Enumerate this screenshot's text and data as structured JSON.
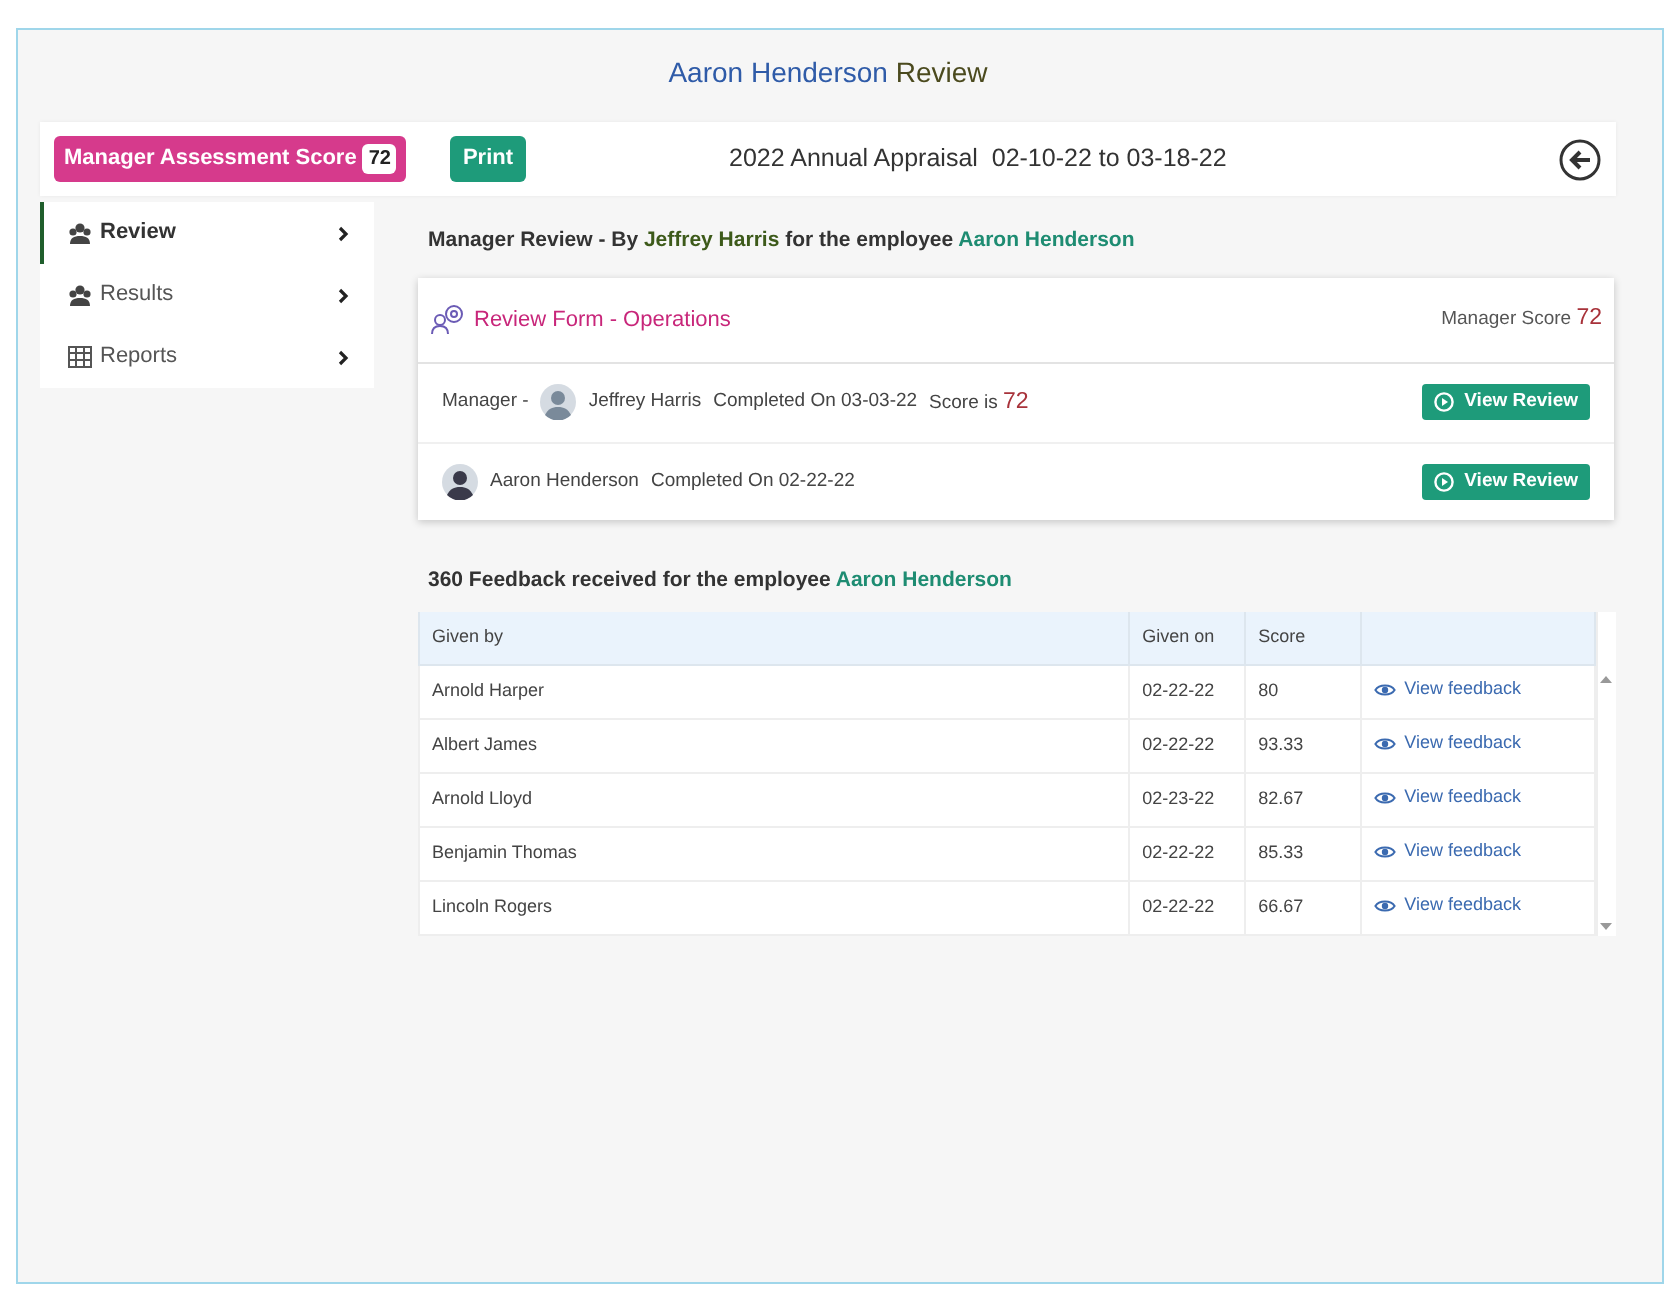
{
  "title": {
    "name": "Aaron Henderson",
    "suffix": "Review"
  },
  "toolbar": {
    "score_label": "Manager Assessment Score",
    "score": "72",
    "print": "Print",
    "appraisal": "2022 Annual Appraisal",
    "date_from": "02-10-22",
    "date_to_word": "to",
    "date_to": "03-18-22"
  },
  "sidebar": {
    "items": [
      {
        "label": "Review",
        "kind": "team",
        "selected": true
      },
      {
        "label": "Results",
        "kind": "team",
        "selected": false
      },
      {
        "label": "Reports",
        "kind": "report",
        "selected": false
      }
    ]
  },
  "manager_review": {
    "heading": [
      {
        "text": "Manager Review - By ",
        "kind": "plain"
      },
      {
        "text": "Jeffrey Harris",
        "kind": "manager"
      },
      {
        "text": " for the employee ",
        "kind": "plain"
      },
      {
        "text": "Aaron Henderson",
        "kind": "employee"
      }
    ],
    "form_title": "Review Form - Operations",
    "score_label": "Manager Score",
    "score": "72",
    "rows": [
      {
        "role": "Manager -",
        "name": "Jeffrey Harris",
        "completed": "Completed On 03-03-22",
        "score_label": "Score is",
        "score": "72",
        "button": "View Review"
      },
      {
        "name": "Aaron Henderson",
        "completed": "Completed On 02-22-22",
        "button": "View Review"
      }
    ]
  },
  "feedback": {
    "heading": [
      {
        "text": "360 Feedback received for the employee ",
        "kind": "plain"
      },
      {
        "text": "Aaron Henderson",
        "kind": "employee"
      }
    ],
    "columns": [
      "Given by",
      "Given on",
      "Score"
    ],
    "rows": [
      {
        "given_by": "Arnold Harper",
        "given_on": "02-22-22",
        "score": "80",
        "action": "View feedback"
      },
      {
        "given_by": "Albert James",
        "given_on": "02-22-22",
        "score": "93.33",
        "action": "View feedback"
      },
      {
        "given_by": "Arnold Lloyd",
        "given_on": "02-23-22",
        "score": "82.67",
        "action": "View feedback"
      },
      {
        "given_by": "Benjamin Thomas",
        "given_on": "02-22-22",
        "score": "85.33",
        "action": "View feedback"
      },
      {
        "given_by": "Lincoln Rogers",
        "given_on": "02-22-22",
        "score": "66.67",
        "action": "View feedback"
      }
    ]
  }
}
